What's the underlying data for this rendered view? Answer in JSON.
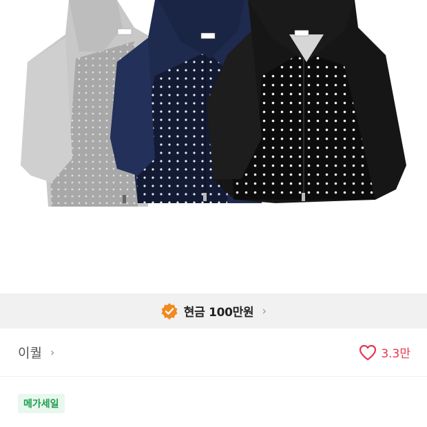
{
  "product": {
    "image_alt_colors": [
      "#c6c6c6",
      "#1d2748",
      "#161616"
    ]
  },
  "promo": {
    "text": "현금 100만원",
    "badge_color": "#f18a1e",
    "icon": "check-badge-icon"
  },
  "store": {
    "name": "이퀄",
    "like_count": "3.3만",
    "like_color": "#e8364f"
  },
  "tags": {
    "mega_sale": "메가세일"
  },
  "title": {
    "text": ""
  }
}
